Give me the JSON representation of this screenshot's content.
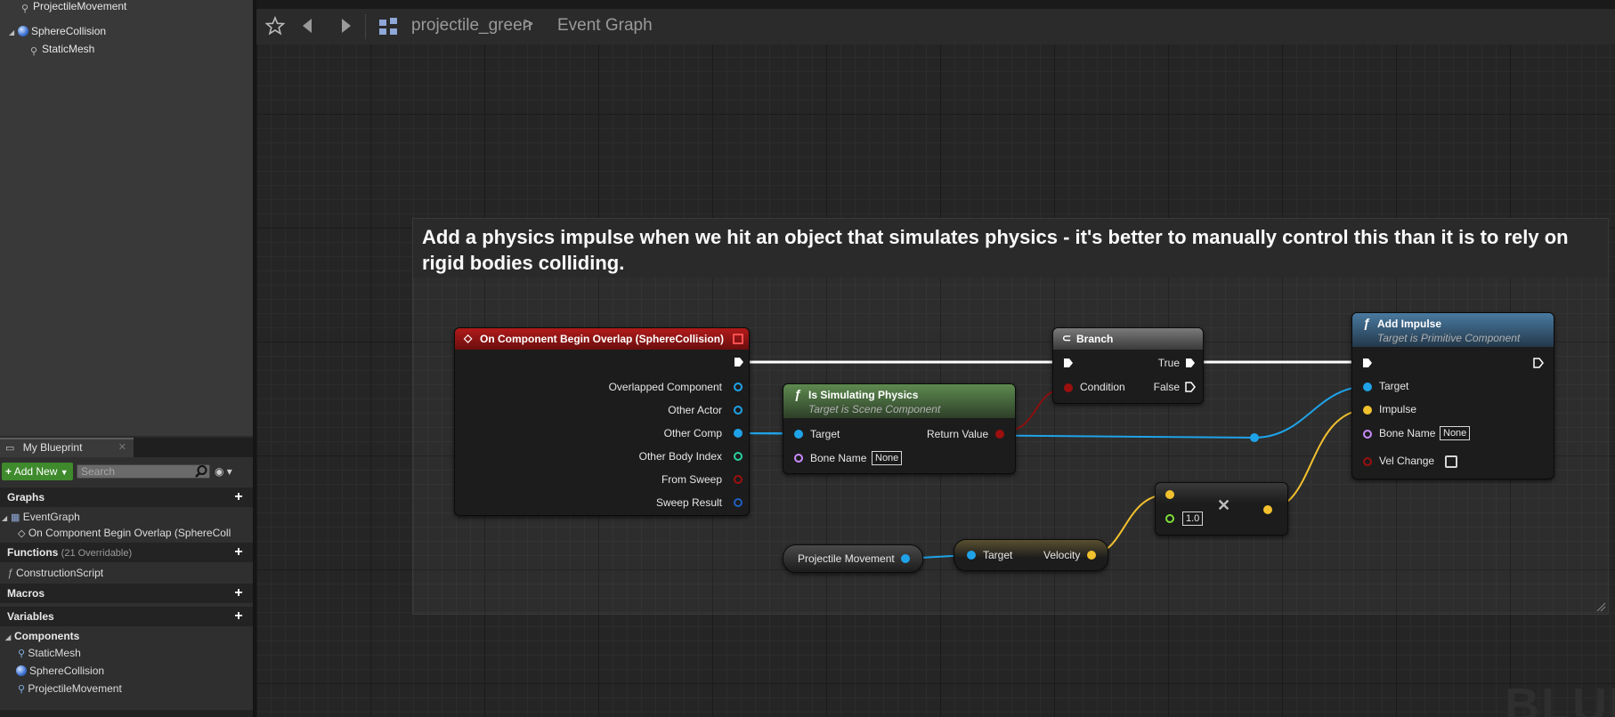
{
  "components_tree": {
    "items": [
      {
        "label": "ProjectileMovement",
        "icon": "projectile-movement-icon"
      },
      {
        "label": "SphereCollision",
        "icon": "sphere-icon"
      },
      {
        "label": "StaticMesh",
        "icon": "static-mesh-icon"
      }
    ]
  },
  "my_blueprint": {
    "tab_label": "My Blueprint",
    "close_glyph": "✕",
    "add_new_label": "Add New",
    "search_placeholder": "Search",
    "sections": {
      "graphs": {
        "label": "Graphs",
        "items": [
          "EventGraph"
        ],
        "sub_items": [
          "On Component Begin Overlap (SphereColl"
        ]
      },
      "functions": {
        "label": "Functions",
        "count": "(21 Overridable)",
        "items": [
          "ConstructionScript"
        ]
      },
      "macros": {
        "label": "Macros"
      },
      "variables": {
        "label": "Variables"
      },
      "components": {
        "label": "Components",
        "items": [
          "StaticMesh",
          "SphereCollision",
          "ProjectileMovement"
        ]
      }
    }
  },
  "toolbar": {
    "breadcrumb_blueprint": "projectile_green",
    "breadcrumb_separator": ">",
    "breadcrumb_graph": "Event Graph"
  },
  "comment": {
    "text": "Add a physics impulse when we hit an object that simulates physics - it's better to manually control this than it is to rely on rigid bodies colliding."
  },
  "nodes": {
    "overlap": {
      "title": "On Component Begin Overlap (SphereCollision)",
      "pins": [
        "Overlapped Component",
        "Other Actor",
        "Other Comp",
        "Other Body Index",
        "From Sweep",
        "Sweep Result"
      ]
    },
    "is_simulating": {
      "title": "Is Simulating Physics",
      "subtitle": "Target is Scene Component",
      "target_label": "Target",
      "bone_label": "Bone Name",
      "bone_value": "None",
      "return_label": "Return Value"
    },
    "branch": {
      "title": "Branch",
      "condition_label": "Condition",
      "true_label": "True",
      "false_label": "False"
    },
    "add_impulse": {
      "title": "Add Impulse",
      "subtitle": "Target is Primitive Component",
      "target_label": "Target",
      "impulse_label": "Impulse",
      "bone_label": "Bone Name",
      "bone_value": "None",
      "vel_change_label": "Vel Change",
      "vel_change_checked": false
    },
    "projectile_var": {
      "label": "Projectile Movement"
    },
    "velocity_get": {
      "target_label": "Target",
      "velocity_label": "Velocity"
    },
    "multiply": {
      "value": "1.0",
      "op_glyph": "✕"
    }
  },
  "watermark": "BLUE",
  "colors": {
    "exec": "#ffffff",
    "object_pin": "#1fa3e8",
    "vector_pin": "#f2c12e",
    "bool_pin": "#9c0f0f",
    "name_pin": "#c98bff",
    "int_pin": "#29d1a0",
    "float_pin": "#7ee03a",
    "struct_pin": "#1f5fbf",
    "event_header": "#8a1414",
    "pure_function_header": "#4f6e45",
    "function_header": "#3f6583",
    "add_new": "#3e8a2c"
  }
}
